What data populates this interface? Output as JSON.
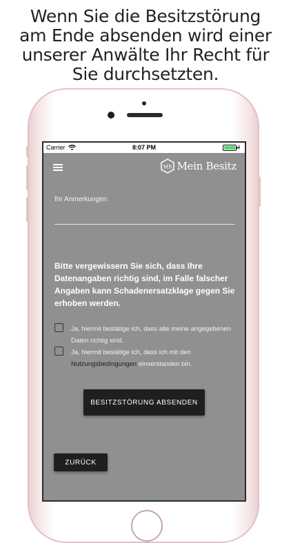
{
  "headline": {
    "lines": [
      "Wenn Sie die Besitzstörung",
      "am Ende absenden wird einer",
      "unserer Anwälte Ihr Recht für",
      "Sie durchsetzten."
    ]
  },
  "statusbar": {
    "carrier": "Carrier",
    "time": "8:07 PM"
  },
  "app": {
    "logo_text": "Mein Besitz",
    "logo_mark": "MB"
  },
  "form": {
    "notes_label": "Ihr Anmerkungen",
    "notes_value": "",
    "warning": "Bitte vergewissern Sie sich, dass Ihre Datenangaben richtig sind, im Falle falscher Angaben kann Schadenersatzklage gegen Sie erhoben werden.",
    "confirm_data": "Ja, hiermit bestätige ich, dass alle meine angegebenen Daten richtig sind.",
    "confirm_terms_prefix": "Ja, hiermit bestätige ich, dass ich mit den",
    "terms_link": "Nutzungsbedingungen",
    "confirm_terms_suffix": " einverstanden bin.",
    "submit_label": "BESITZSTÖRUNG ABSENDEN",
    "back_label": "ZURÜCK"
  },
  "colors": {
    "screen_bg": "#909090",
    "button_bg": "#1f1f1f",
    "frame": "#e9cfd0",
    "battery": "#4cd964"
  },
  "icons": [
    "wifi-icon",
    "battery-icon",
    "menu-icon",
    "logo-icon"
  ]
}
